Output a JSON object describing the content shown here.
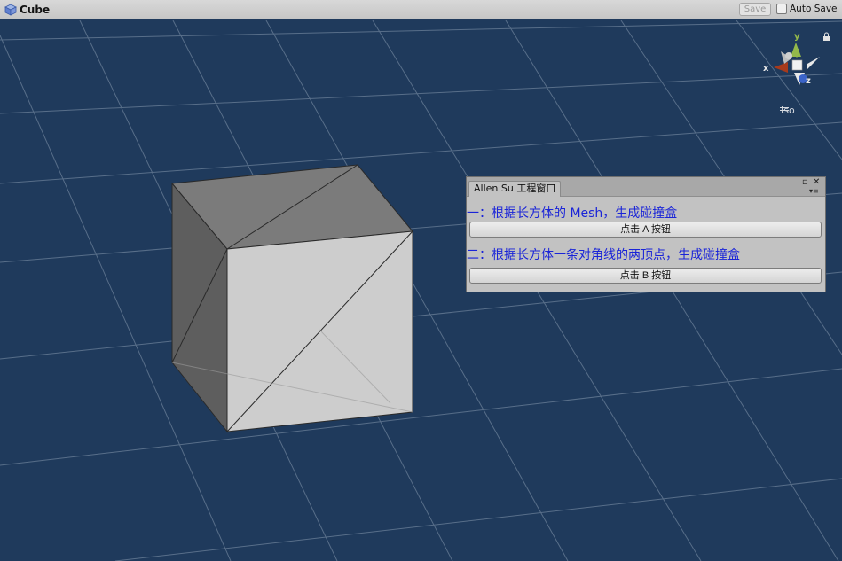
{
  "header": {
    "title": "Cube",
    "save_label": "Save",
    "auto_save_label": "Auto Save",
    "auto_save_checked": false
  },
  "scene": {
    "view_mode": "Iso",
    "axis_labels": {
      "x": "x",
      "y": "y",
      "z": "z"
    },
    "colors": {
      "background": "#1f3a5c",
      "grid": "#6b8099",
      "x_axis": "#a63a1c",
      "y_axis": "#93b84a",
      "z_axis": "#3b64c9"
    }
  },
  "window": {
    "tab_title": "Allen Su 工程窗口",
    "label_a": "一：根据长方体的 Mesh，生成碰撞盒",
    "button_a": "点击 A 按钮",
    "label_b": "二：根据长方体一条对角线的两顶点，生成碰撞盒",
    "button_b": "点击 B 按钮"
  }
}
